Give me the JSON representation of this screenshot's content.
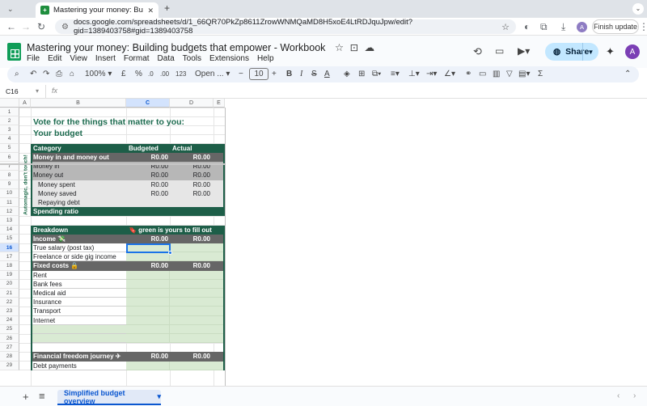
{
  "browser": {
    "tab_title": "Mastering your money: Buildi",
    "tab_close": "✕",
    "new_tab": "+",
    "url": "docs.google.com/spreadsheets/d/1_66QR70PkZp8611ZrowWNMQaMD8H5xoE4LtRDJquJpw/edit?gid=1389403758#gid=1389403758",
    "finish_update": "Finish update",
    "profile_initial": "A"
  },
  "app": {
    "doc_title": "Mastering your money: Building budgets that empower - Workbook",
    "menus": [
      "File",
      "Edit",
      "View",
      "Insert",
      "Format",
      "Data",
      "Tools",
      "Extensions",
      "Help"
    ],
    "share_label": "Share",
    "avatar_initial": "A"
  },
  "toolbar": {
    "zoom": "100%",
    "currency": "£",
    "percent": "%",
    "decrease_decimal": ".0",
    "increase_decimal": ".00",
    "number_format": "123",
    "font": "Open ...",
    "font_size": "10"
  },
  "formula_bar": {
    "name_box": "C16",
    "fx": "fx"
  },
  "columns": [
    "A",
    "B",
    "C",
    "D",
    "E"
  ],
  "rows": [
    "1",
    "2",
    "3",
    "4",
    "5",
    "6",
    "7",
    "8",
    "9",
    "10",
    "11",
    "12",
    "13",
    "14",
    "15",
    "16",
    "17",
    "18",
    "19",
    "20",
    "21",
    "22",
    "23",
    "24",
    "25",
    "26",
    "27",
    "28",
    "29"
  ],
  "sheet": {
    "title_line1": "Vote for the things that matter to you:",
    "title_line2": "Your budget",
    "side_label": "Automagic, don't touch!",
    "header": {
      "category": "Category",
      "budgeted": "Budgeted",
      "actual": "Actual"
    },
    "summary_rows": [
      {
        "label": "Money in and money out",
        "budgeted": "R0.00",
        "actual": "R0.00"
      },
      {
        "label": "Money in",
        "budgeted": "R0.00",
        "actual": "R0.00"
      },
      {
        "label": "Money out",
        "budgeted": "R0.00",
        "actual": "R0.00"
      },
      {
        "label": "Money spent",
        "budgeted": "R0.00",
        "actual": "R0.00"
      },
      {
        "label": "Money saved",
        "budgeted": "R0.00",
        "actual": "R0.00"
      },
      {
        "label": "Repaying debt",
        "budgeted": "",
        "actual": ""
      },
      {
        "label": "Spending ratio",
        "budgeted": "",
        "actual": ""
      }
    ],
    "breakdown_header": {
      "label": "Breakdown",
      "note": "🔖 green is yours to fill out"
    },
    "income": {
      "label": "Income 💸",
      "budgeted": "R0.00",
      "actual": "R0.00",
      "items": [
        "True salary (post tax)",
        "Freelance or side gig income"
      ]
    },
    "fixed": {
      "label": "Fixed costs 🔒",
      "budgeted": "R0.00",
      "actual": "R0.00",
      "items": [
        "Rent",
        "Bank fees",
        "Medical aid",
        "Insurance",
        "Transport",
        "Internet"
      ]
    },
    "freedom": {
      "label": "Financial freedom journey ✈",
      "budgeted": "R0.00",
      "actual": "R0.00",
      "items": [
        "Debt payments"
      ]
    }
  },
  "bottom": {
    "add": "+",
    "list": "≡",
    "sheet_tab": "Simplified budget overview",
    "dropdown": "▾"
  },
  "colors": {
    "dark_green": "#1d5e48",
    "brand_green": "#0f9d58",
    "light_green": "#d9ead3",
    "grey_band": "#666666",
    "title_green": "#1d6b4f"
  }
}
